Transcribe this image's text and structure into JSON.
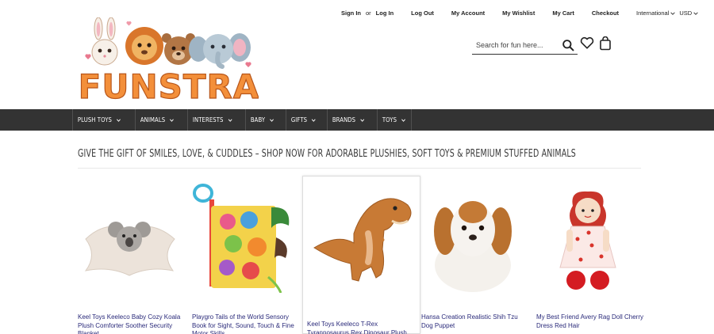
{
  "header": {
    "links": [
      "Sign In",
      "or",
      "Log In",
      "Log Out",
      "My Account",
      "My Wishlist",
      "My Cart",
      "Checkout"
    ],
    "region": "International",
    "currency": "USD",
    "logo_text": "FUNSTRA"
  },
  "search": {
    "placeholder": "Search for fun here..."
  },
  "nav": {
    "items": [
      {
        "label": "PLUSH TOYS"
      },
      {
        "label": "ANIMALS"
      },
      {
        "label": "INTERESTS"
      },
      {
        "label": "BABY"
      },
      {
        "label": "GIFTS"
      },
      {
        "label": "BRANDS"
      },
      {
        "label": "TOYS"
      }
    ]
  },
  "tagline": "GIVE THE GIFT OF SMILES, LOVE, & CUDDLES – SHOP NOW FOR ADORABLE PLUSHIES, SOFT TOYS & PREMIUM STUFFED ANIMALS",
  "products": [
    {
      "title": "Keel Toys Keeleco Baby Cozy Koala Plush Comforter Soother Security Blanket"
    },
    {
      "title": "Playgro Tails of the World Sensory Book for Sight, Sound, Touch & Fine Motor Skills"
    },
    {
      "title": "Keel Toys Keeleco T-Rex Tyrannosaurus Rex Dinosaur Plush"
    },
    {
      "title": "Hansa Creation Realistic Shih Tzu Dog Puppet"
    },
    {
      "title": "My Best Friend Avery Rag Doll Cherry Dress Red Hair"
    }
  ],
  "colors": {
    "nav_bg": "#333333",
    "product_title": "#2a2a7a"
  }
}
